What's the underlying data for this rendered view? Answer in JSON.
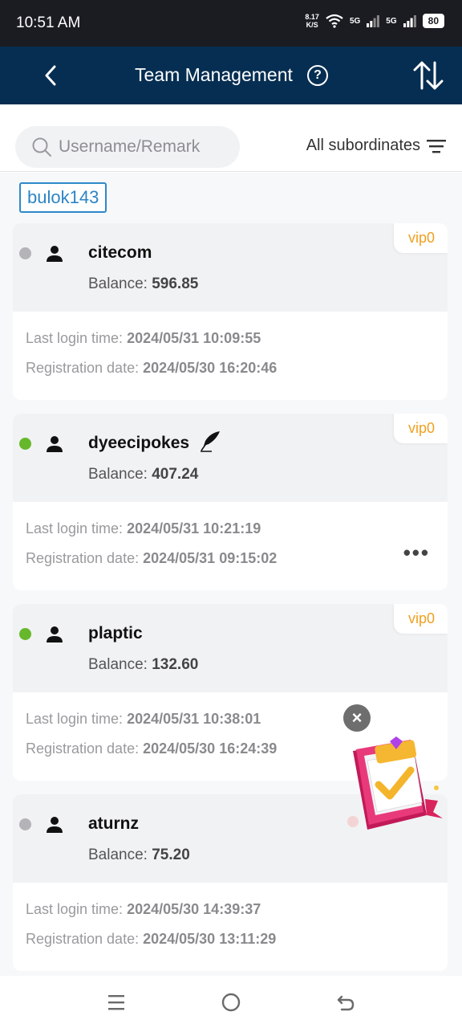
{
  "status_bar": {
    "time": "10:51 AM",
    "speed_value": "8.17",
    "speed_unit": "K/S",
    "net1": "5G",
    "net2": "5G",
    "battery": "80"
  },
  "header": {
    "title": "Team Management",
    "help": "?"
  },
  "search": {
    "placeholder": "Username/Remark",
    "value": ""
  },
  "filter": {
    "label": "All subordinates"
  },
  "selected_user": "bulok143",
  "labels": {
    "balance": "Balance:",
    "last_login": "Last login time:",
    "registration": "Registration date:",
    "more": "•••"
  },
  "members": [
    {
      "username": "citecom",
      "vip": "vip0",
      "balance": "596.85",
      "last_login": "2024/05/31 10:09:55",
      "registration": "2024/05/30 16:20:46",
      "online": false,
      "dot_color": "#b4b4b8",
      "has_note": false
    },
    {
      "username": "dyeecipokes",
      "vip": "vip0",
      "balance": "407.24",
      "last_login": "2024/05/31 10:21:19",
      "registration": "2024/05/31 09:15:02",
      "online": true,
      "dot_color": "#66b82a",
      "has_note": true
    },
    {
      "username": "plaptic",
      "vip": "vip0",
      "balance": "132.60",
      "last_login": "2024/05/31 10:38:01",
      "registration": "2024/05/30 16:24:39",
      "online": true,
      "dot_color": "#66b82a",
      "has_note": false
    },
    {
      "username": "aturnz",
      "vip": "vip0",
      "balance": "75.20",
      "last_login": "2024/05/30 14:39:37",
      "registration": "2024/05/30 13:11:29",
      "online": false,
      "dot_color": "#b4b4b8",
      "has_note": false
    }
  ],
  "promo": {
    "close": "×"
  },
  "colors": {
    "header_bg": "#062e52",
    "vip": "#f0a020",
    "tag": "#2d84c6",
    "online": "#66b82a",
    "offline": "#b4b4b8"
  },
  "icons": {
    "back": "chevron-left-icon",
    "help": "question-circle-icon",
    "sort": "sort-arrows-icon",
    "search": "search-icon",
    "filter": "filter-lines-icon",
    "person": "person-icon",
    "note": "quill-icon",
    "more": "more-dots-icon"
  }
}
